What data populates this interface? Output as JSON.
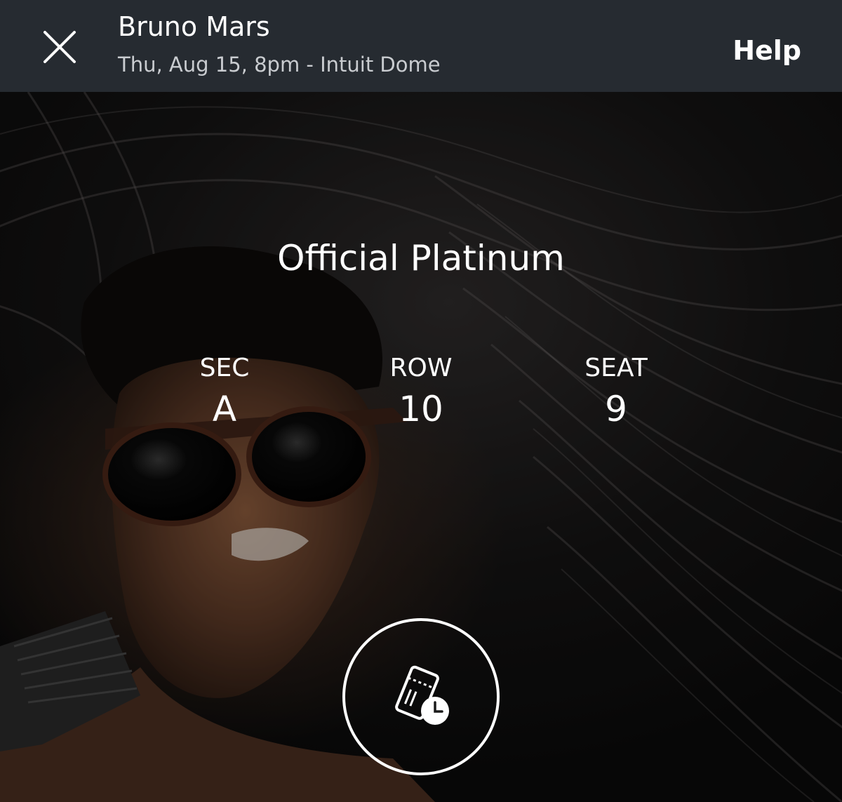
{
  "header": {
    "title": "Bruno Mars",
    "subtitle": "Thu, Aug 15, 8pm - Intuit Dome",
    "close_icon": "close-icon",
    "help_label": "Help"
  },
  "ticket": {
    "type": "Official Platinum",
    "section": {
      "label": "SEC",
      "value": "A"
    },
    "row": {
      "label": "ROW",
      "value": "10"
    },
    "seat": {
      "label": "SEAT",
      "value": "9"
    },
    "action_icon": "ticket-clock-icon"
  },
  "colors": {
    "header_bg": "#262b31",
    "text": "#ffffff",
    "subtitle": "#c9ccd0"
  }
}
